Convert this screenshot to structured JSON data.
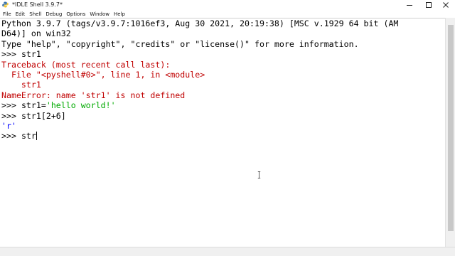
{
  "window": {
    "title": "*IDLE Shell 3.9.7*"
  },
  "menu": {
    "items": [
      "File",
      "Edit",
      "Shell",
      "Debug",
      "Options",
      "Window",
      "Help"
    ]
  },
  "shell": {
    "banner_line1": "Python 3.9.7 (tags/v3.9.7:1016ef3, Aug 30 2021, 20:19:38) [MSC v.1929 64 bit (AM",
    "banner_line2": "D64)] on win32",
    "banner_line3": "Type \"help\", \"copyright\", \"credits\" or \"license()\" for more information.",
    "prompt": ">>>",
    "cmd1": "str1",
    "traceback_header": "Traceback (most recent call last):",
    "traceback_file": "  File \"<pyshell#0>\", line 1, in <module>",
    "traceback_code": "    str1",
    "error_message": "NameError: name 'str1' is not defined",
    "cmd2_prefix": "str1=",
    "cmd2_string": "'hello world!'",
    "cmd3": "str1[2+6]",
    "output3": "'r'",
    "current_input": "str"
  },
  "colors": {
    "error": "#c00000",
    "string": "#00aa00",
    "output": "#0000ff"
  }
}
